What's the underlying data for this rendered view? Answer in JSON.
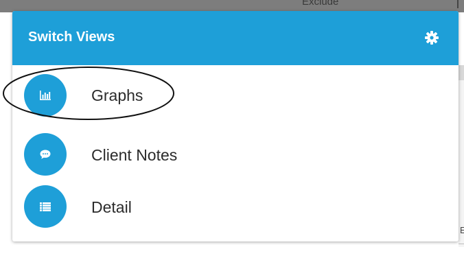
{
  "background": {
    "header_text": "Exclude"
  },
  "dialog": {
    "title": "Switch Views",
    "settings_icon": "gear-icon",
    "accent_color": "#1e9fd8",
    "views": [
      {
        "label": "Graphs",
        "icon": "bar-chart-icon",
        "highlighted": true
      },
      {
        "label": "Client Notes",
        "icon": "speech-bubble-icon",
        "highlighted": false
      },
      {
        "label": "Detail",
        "icon": "list-icon",
        "highlighted": false
      }
    ]
  }
}
